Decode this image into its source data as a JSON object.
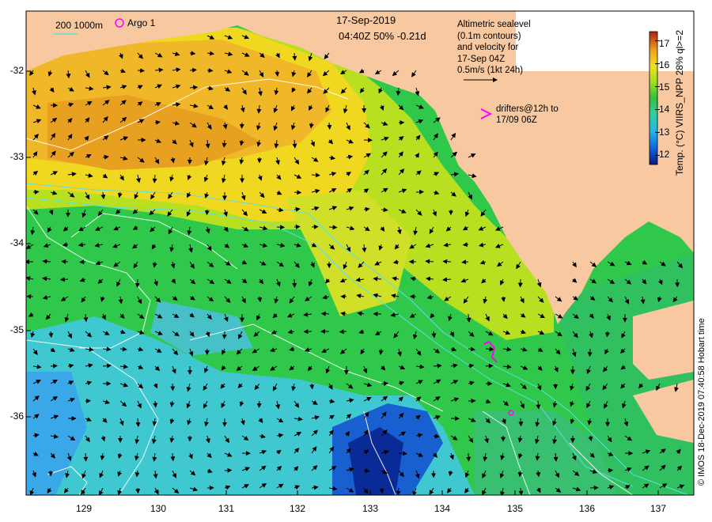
{
  "map": {
    "date": "17-Sep-2019",
    "time_line": "04:40Z  50% -0.21d",
    "depth_legend": "200  1000m",
    "argo_label": "Argo 1",
    "altimetry_note": [
      "Altimetric sealevel",
      "(0.1m contours)",
      "and velocity for",
      "17-Sep 04Z",
      "0.5m/s (1kt 24h)"
    ],
    "drifters_note": [
      "drifters@12h to",
      "17/09 06Z"
    ],
    "lat_ticks": [
      "-32",
      "-33",
      "-34",
      "-35",
      "-36"
    ],
    "lon_ticks": [
      "129",
      "130",
      "131",
      "132",
      "133",
      "134",
      "135",
      "136",
      "137"
    ],
    "colorbar": {
      "ticks": [
        "17",
        "16",
        "15",
        "14",
        "13",
        "12"
      ],
      "label": "Temp. (°C)  VIIRS_NPP  28%  ql>=2",
      "min": 11.6,
      "max": 17.4
    },
    "credit": "© IMOS 18-Dec-2019 07:40:58 Hobart time",
    "colors": {
      "land": "#f8c9a0",
      "depth_contour": "#5ce0e0",
      "sealevel_contour": "#ffffff",
      "argo": "#ff00ff",
      "drifter": "#ff00ff",
      "arrow": "#000000"
    }
  }
}
